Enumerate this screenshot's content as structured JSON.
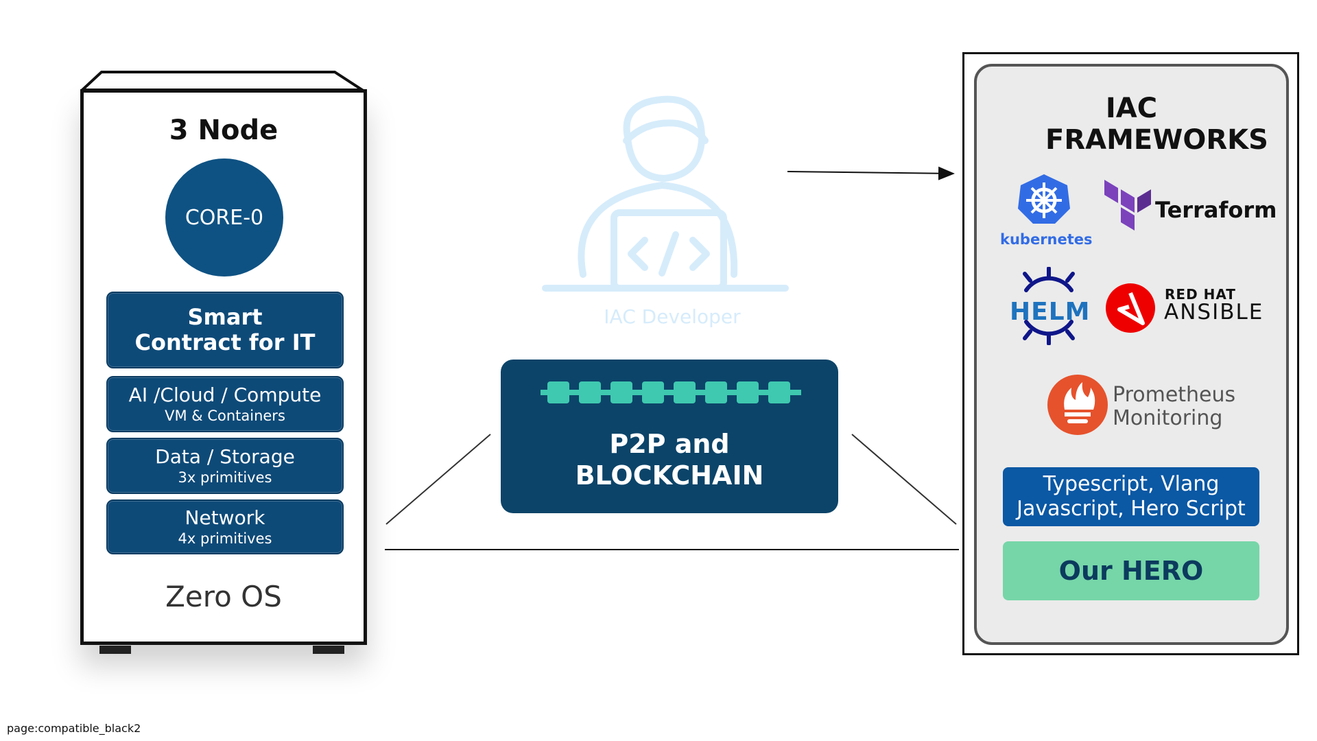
{
  "node": {
    "title": "3 Node",
    "core_label": "CORE-0",
    "smart_contract": "Smart Contract for IT",
    "compute": {
      "main": "AI /Cloud / Compute",
      "sub": "VM & Containers"
    },
    "storage": {
      "main": "Data / Storage",
      "sub": "3x primitives"
    },
    "network": {
      "main": "Network",
      "sub": "4x primitives"
    },
    "os_label": "Zero OS"
  },
  "developer": {
    "label": "IAC Developer"
  },
  "p2p": {
    "title": "P2P and BLOCKCHAIN"
  },
  "iac": {
    "title": "IAC FRAMEWORKS",
    "kubernetes": "kubernetes",
    "terraform": "Terraform",
    "helm": "HELM",
    "redhat_top": "RED HAT",
    "redhat_bottom": "ANSIBLE",
    "prometheus_line1": "Prometheus",
    "prometheus_line2": "Monitoring",
    "languages_line1": "Typescript, Vlang",
    "languages_line2": "Javascript, Hero Script",
    "hero": "Our HERO"
  },
  "colors": {
    "node_block": "#0e4a78",
    "core": "#0e5283",
    "p2p": "#0c4469",
    "chain": "#3fc9b0",
    "language_box": "#0b58a4",
    "hero_box": "#76d6a8",
    "kubernetes": "#326ce5",
    "terraform": "#7b42bc",
    "helm": "#0f1689",
    "redhat": "#ee0000",
    "prometheus": "#e6522c"
  },
  "footer": {
    "page_label": "page:compatible_black2"
  }
}
